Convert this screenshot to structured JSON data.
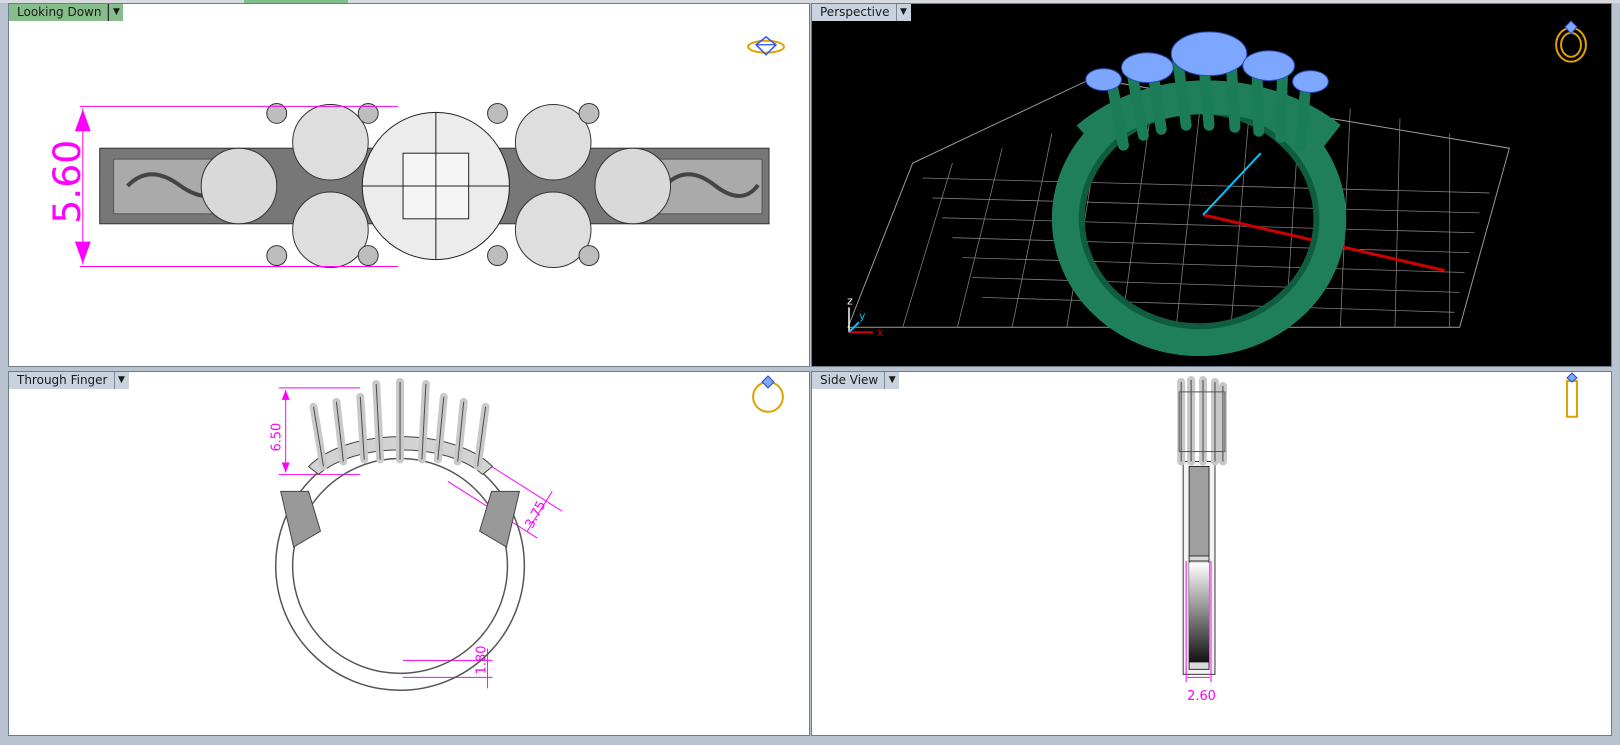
{
  "viewports": [
    {
      "id": "top-left",
      "label": "Looking Down",
      "active": true
    },
    {
      "id": "top-right",
      "label": "Perspective",
      "active": false
    },
    {
      "id": "bottom-left",
      "label": "Through Finger",
      "active": false
    },
    {
      "id": "bottom-right",
      "label": "Side View",
      "active": false
    }
  ],
  "dimensions": {
    "looking_down_height": "5.60",
    "through_finger_height": "6.50",
    "through_finger_side": "3.75",
    "through_finger_bottom": "1.80",
    "side_view_width": "2.60"
  },
  "axis_labels": {
    "z": "z",
    "y": "y",
    "x": "x"
  },
  "icons": {
    "top_view_icon": "ring-top-icon",
    "perspective_icon": "ring-perspective-icon",
    "finger_view_icon": "ring-front-icon",
    "side_view_icon": "ring-side-icon"
  },
  "colors": {
    "dimension": "#ff00ff",
    "ring_green": "#1f7f5a",
    "gem_blue": "#7da7ff",
    "grid": "#8a8a8a",
    "axis_red": "#d10000",
    "axis_cyan": "#00c5ff",
    "icon_gold": "#e0a100"
  }
}
